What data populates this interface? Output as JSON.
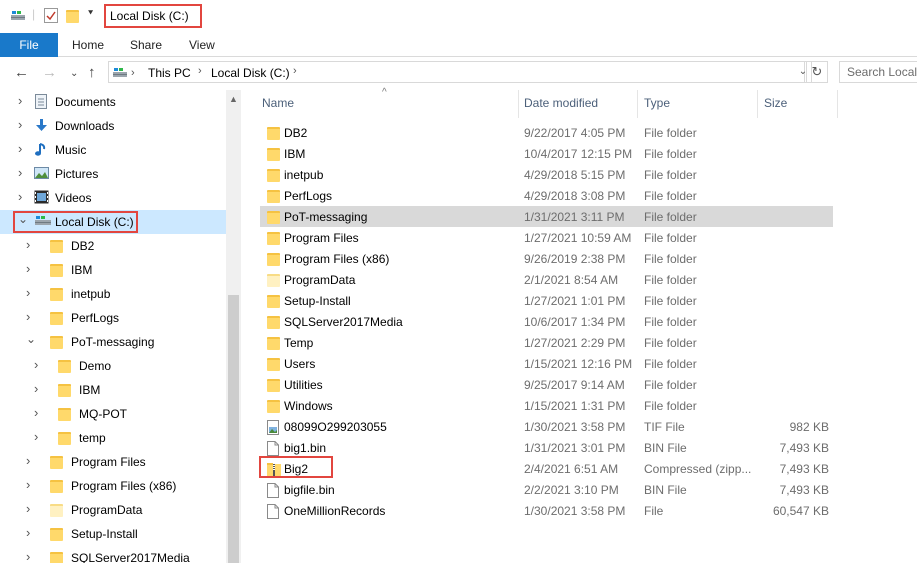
{
  "window": {
    "title": "Local Disk (C:)"
  },
  "ribbon": {
    "file": "File",
    "tabs": [
      "Home",
      "Share",
      "View"
    ]
  },
  "address": {
    "crumbs": [
      "This PC",
      "Local Disk (C:)"
    ],
    "search_placeholder": "Search Local"
  },
  "tree": {
    "items": [
      {
        "label": "Documents",
        "icon": "documents-icon",
        "level": 0
      },
      {
        "label": "Downloads",
        "icon": "downloads-icon",
        "level": 0
      },
      {
        "label": "Music",
        "icon": "music-icon",
        "level": 0
      },
      {
        "label": "Pictures",
        "icon": "pictures-icon",
        "level": 0
      },
      {
        "label": "Videos",
        "icon": "videos-icon",
        "level": 0
      },
      {
        "label": "Local Disk (C:)",
        "icon": "drive-icon",
        "level": 0,
        "expanded": true,
        "selected": true
      },
      {
        "label": "DB2",
        "icon": "folder-icon",
        "level": 1
      },
      {
        "label": "IBM",
        "icon": "folder-icon",
        "level": 1
      },
      {
        "label": "inetpub",
        "icon": "folder-icon",
        "level": 1
      },
      {
        "label": "PerfLogs",
        "icon": "folder-icon",
        "level": 1
      },
      {
        "label": "PoT-messaging",
        "icon": "folder-icon",
        "level": 1,
        "expanded": true
      },
      {
        "label": "Demo",
        "icon": "folder-icon",
        "level": 2
      },
      {
        "label": "IBM",
        "icon": "folder-icon",
        "level": 2
      },
      {
        "label": "MQ-POT",
        "icon": "folder-icon",
        "level": 2
      },
      {
        "label": "temp",
        "icon": "folder-icon",
        "level": 2
      },
      {
        "label": "Program Files",
        "icon": "folder-icon",
        "level": 1
      },
      {
        "label": "Program Files (x86)",
        "icon": "folder-icon",
        "level": 1
      },
      {
        "label": "ProgramData",
        "icon": "folder-icon",
        "level": 1,
        "light": true
      },
      {
        "label": "Setup-Install",
        "icon": "folder-icon",
        "level": 1
      },
      {
        "label": "SQLServer2017Media",
        "icon": "folder-icon",
        "level": 1
      }
    ]
  },
  "list": {
    "headers": {
      "name": "Name",
      "date": "Date modified",
      "type": "Type",
      "size": "Size"
    },
    "rows": [
      {
        "name": "DB2",
        "date": "9/22/2017 4:05 PM",
        "type": "File folder",
        "size": "",
        "icon": "folder-icon"
      },
      {
        "name": "IBM",
        "date": "10/4/2017 12:15 PM",
        "type": "File folder",
        "size": "",
        "icon": "folder-icon"
      },
      {
        "name": "inetpub",
        "date": "4/29/2018 5:15 PM",
        "type": "File folder",
        "size": "",
        "icon": "folder-icon"
      },
      {
        "name": "PerfLogs",
        "date": "4/29/2018 3:08 PM",
        "type": "File folder",
        "size": "",
        "icon": "folder-icon"
      },
      {
        "name": "PoT-messaging",
        "date": "1/31/2021 3:11 PM",
        "type": "File folder",
        "size": "",
        "icon": "folder-icon",
        "selected": true
      },
      {
        "name": "Program Files",
        "date": "1/27/2021 10:59 AM",
        "type": "File folder",
        "size": "",
        "icon": "folder-icon"
      },
      {
        "name": "Program Files (x86)",
        "date": "9/26/2019 2:38 PM",
        "type": "File folder",
        "size": "",
        "icon": "folder-icon"
      },
      {
        "name": "ProgramData",
        "date": "2/1/2021 8:54 AM",
        "type": "File folder",
        "size": "",
        "icon": "folder-icon",
        "light": true
      },
      {
        "name": "Setup-Install",
        "date": "1/27/2021 1:01 PM",
        "type": "File folder",
        "size": "",
        "icon": "folder-icon"
      },
      {
        "name": "SQLServer2017Media",
        "date": "10/6/2017 1:34 PM",
        "type": "File folder",
        "size": "",
        "icon": "folder-icon"
      },
      {
        "name": "Temp",
        "date": "1/27/2021 2:29 PM",
        "type": "File folder",
        "size": "",
        "icon": "folder-icon"
      },
      {
        "name": "Users",
        "date": "1/15/2021 12:16 PM",
        "type": "File folder",
        "size": "",
        "icon": "folder-icon"
      },
      {
        "name": "Utilities",
        "date": "9/25/2017 9:14 AM",
        "type": "File folder",
        "size": "",
        "icon": "folder-icon"
      },
      {
        "name": "Windows",
        "date": "1/15/2021 1:31 PM",
        "type": "File folder",
        "size": "",
        "icon": "folder-icon"
      },
      {
        "name": "08099O299203055",
        "date": "1/30/2021 3:58 PM",
        "type": "TIF File",
        "size": "982 KB",
        "icon": "image-file-icon"
      },
      {
        "name": "big1.bin",
        "date": "1/31/2021 3:01 PM",
        "type": "BIN File",
        "size": "7,493 KB",
        "icon": "file-icon"
      },
      {
        "name": "Big2",
        "date": "2/4/2021 6:51 AM",
        "type": "Compressed (zipp...",
        "size": "7,493 KB",
        "icon": "zip-folder-icon"
      },
      {
        "name": "bigfile.bin",
        "date": "2/2/2021 3:10 PM",
        "type": "BIN File",
        "size": "7,493 KB",
        "icon": "file-icon"
      },
      {
        "name": "OneMillionRecords",
        "date": "1/30/2021 3:58 PM",
        "type": "File",
        "size": "60,547 KB",
        "icon": "file-icon"
      }
    ]
  },
  "colors": {
    "accent": "#1979ca",
    "highlight": "#e2463f",
    "selection": "#cce8ff"
  }
}
